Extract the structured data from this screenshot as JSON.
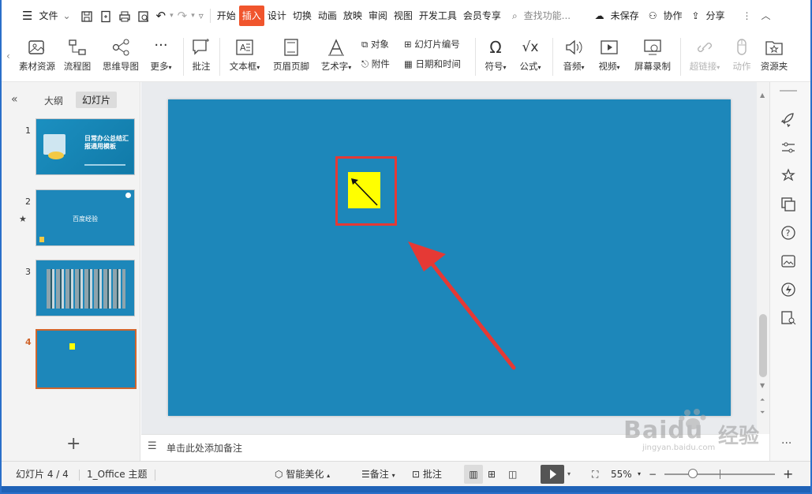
{
  "menubar": {
    "file_label": "文件",
    "tabs": [
      "开始",
      "插入",
      "设计",
      "切换",
      "动画",
      "放映",
      "审阅",
      "视图",
      "开发工具",
      "会员专享"
    ],
    "active_tab": "插入",
    "search_placeholder": "查找功能...",
    "unsaved_label": "未保存",
    "collab_label": "协作",
    "share_label": "分享"
  },
  "ribbon": {
    "items": {
      "resources": "素材资源",
      "flowchart": "流程图",
      "mindmap": "思维导图",
      "more": "更多",
      "comment": "批注",
      "textbox": "文本框",
      "header_footer": "页眉页脚",
      "wordart": "艺术字",
      "object": "对象",
      "slide_number": "幻灯片编号",
      "attachment": "附件",
      "datetime": "日期和时间",
      "symbol": "符号",
      "formula": "公式",
      "audio": "音频",
      "video": "视频",
      "screen_record": "屏幕录制",
      "hyperlink": "超链接",
      "action": "动作",
      "resource_folder": "资源夹"
    }
  },
  "leftpanel": {
    "tab_outline": "大纲",
    "tab_slides": "幻灯片",
    "slides": [
      {
        "number": "1",
        "title": "日常办公总结汇报通用模板"
      },
      {
        "number": "2",
        "title": "百度经验"
      },
      {
        "number": "3",
        "title": ""
      },
      {
        "number": "4",
        "title": ""
      }
    ]
  },
  "notes": {
    "placeholder": "单击此处添加备注"
  },
  "status": {
    "slide_info": "幻灯片 4 / 4",
    "theme": "1_Office 主题",
    "smart_beautify": "智能美化",
    "notes": "备注",
    "comment": "批注",
    "zoom": "55%"
  },
  "watermark": {
    "brand": "Baidu",
    "brand_cn": "经验",
    "url": "jingyan.baidu.com"
  },
  "colors": {
    "slide_bg": "#1d87ba",
    "accent": "#f0552d",
    "highlight_box": "#e53935",
    "shape_fill": "#ffff00"
  }
}
